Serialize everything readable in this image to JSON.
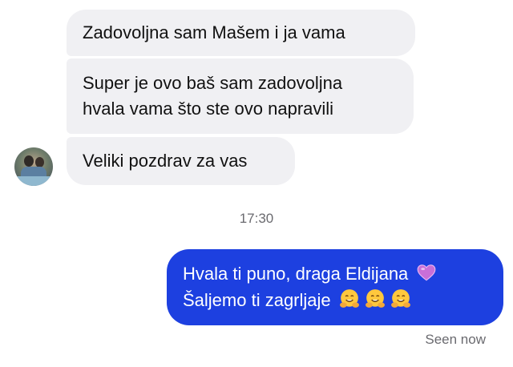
{
  "messages_in": [
    {
      "text": "Zadovoljna sam Mašem i ja vama"
    },
    {
      "line1": "Super je ovo baš sam zadovoljna",
      "line2": "hvala vama što ste ovo napravili"
    },
    {
      "text": "Veliki pozdrav za vas"
    }
  ],
  "timestamp": "17:30",
  "message_out": {
    "line1": "Hvala ti puno, draga Eldijana",
    "line2": "Šaljemo ti zagrljaje",
    "emoji_line1": "purple-heart",
    "emoji_line2": [
      "hugging-face",
      "hugging-face",
      "hugging-face"
    ]
  },
  "status": "Seen now",
  "colors": {
    "outgoing_bubble": "#1d40e0",
    "incoming_bubble": "#f0f0f3"
  }
}
